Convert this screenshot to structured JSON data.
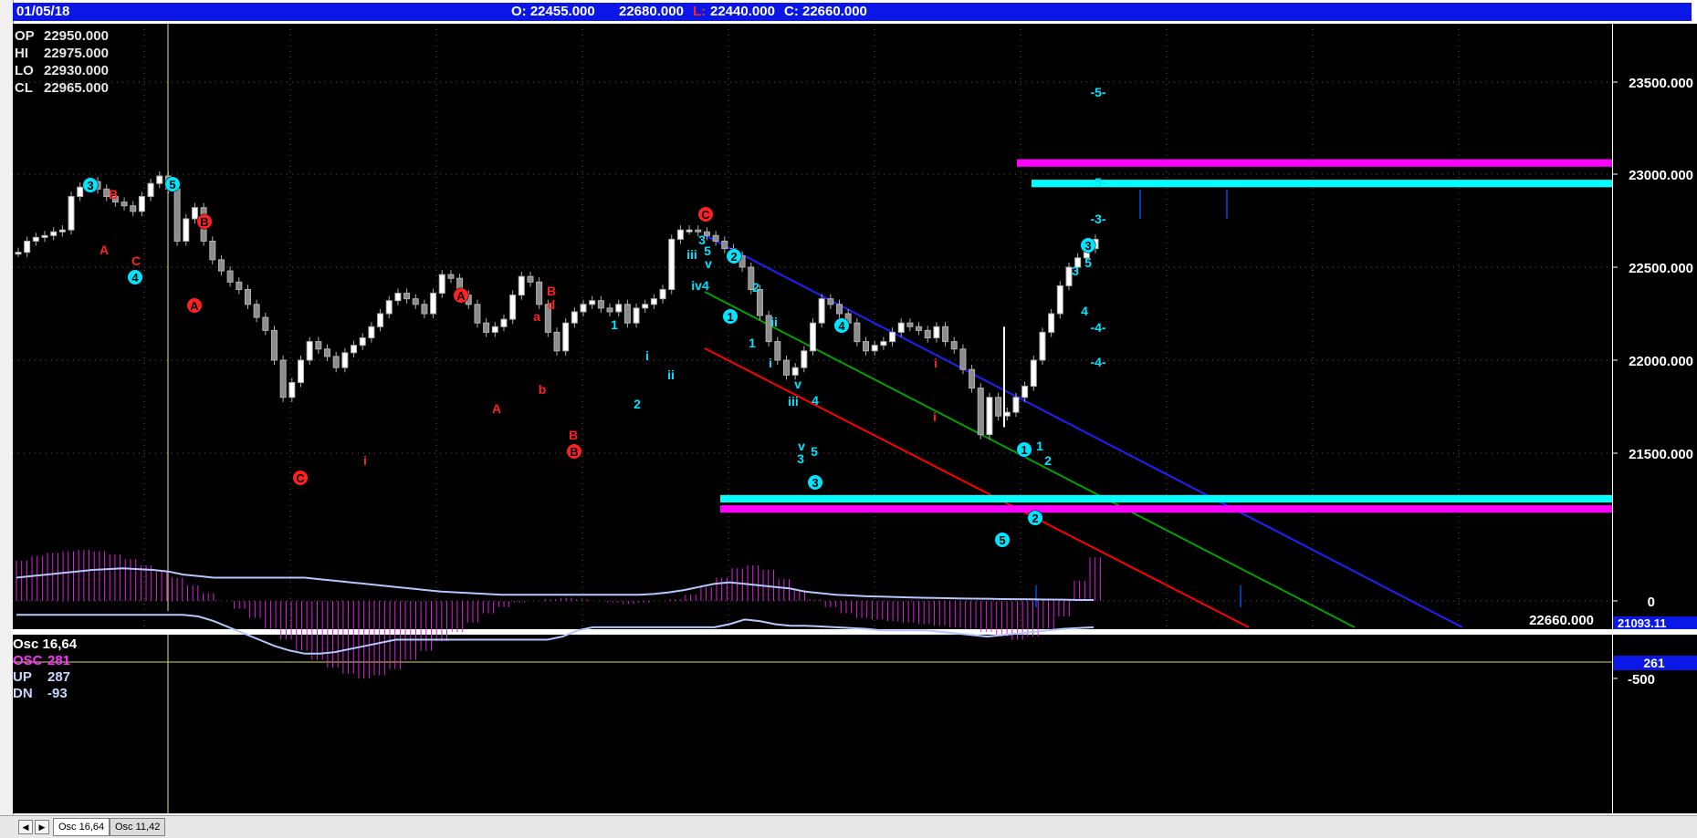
{
  "topbar": {
    "date": "01/05/18",
    "open": "O: 22455.000",
    "high": "22680.000",
    "low_tag": "L:",
    "low": "22440.000",
    "close": "C: 22660.000"
  },
  "ohlc_box": [
    {
      "label": "OP",
      "value": "22950.000"
    },
    {
      "label": "HI",
      "value": "22975.000"
    },
    {
      "label": "LO",
      "value": "22930.000"
    },
    {
      "label": "CL",
      "value": "22965.000"
    }
  ],
  "price_axis": {
    "ticks": [
      "23500.000",
      "23000.000",
      "22500.000",
      "22000.000",
      "21500.000"
    ],
    "last_price": "22660.000",
    "cut_label": "21093.11"
  },
  "osc_legend": [
    {
      "label": "Osc 16,64",
      "value": "",
      "color": "#ffffff"
    },
    {
      "label": "OSC",
      "value": "281",
      "color": "#ff33ff"
    },
    {
      "label": "UP",
      "value": "287",
      "color": "#b4c8ff"
    },
    {
      "label": "DN",
      "value": "-93",
      "color": "#b4c8ff"
    }
  ],
  "osc_axis": {
    "ticks": [
      "0",
      "-500"
    ],
    "current": "261"
  },
  "tabs": [
    "Osc 16,64",
    "Osc 11,42"
  ],
  "colors": {
    "background": "#000000",
    "header": "#0a17e6",
    "candle": "#b0b0b0",
    "wave_red": "#ff2020",
    "wave_cyan": "#00e5ff",
    "histogram": "#e020e0",
    "channel_blue": "#2020ff",
    "channel_green": "#00a000",
    "channel_red": "#ff0000",
    "zone_magenta": "#ff00ff",
    "zone_cyan": "#00ffff"
  },
  "chart_data": {
    "type": "candlestick",
    "price_series": [
      22580,
      22640,
      22660,
      22670,
      22690,
      22700,
      22880,
      22930,
      22960,
      22920,
      22880,
      22850,
      22830,
      22800,
      22880,
      22950,
      22990,
      22920,
      22640,
      22760,
      22820,
      22640,
      22540,
      22480,
      22420,
      22380,
      22300,
      22230,
      22160,
      22000,
      21800,
      21880,
      22000,
      22100,
      22060,
      22020,
      21960,
      22040,
      22080,
      22120,
      22180,
      22250,
      22320,
      22360,
      22330,
      22300,
      22250,
      22360,
      22460,
      22440,
      22350,
      22300,
      22200,
      22150,
      22180,
      22220,
      22350,
      22450,
      22420,
      22300,
      22150,
      22050,
      22200,
      22260,
      22300,
      22320,
      22280,
      22260,
      22300,
      22200,
      22280,
      22300,
      22330,
      22380,
      22650,
      22700,
      22700,
      22690,
      22670,
      22640,
      22600,
      22560,
      22500,
      22380,
      22240,
      22100,
      22000,
      21920,
      21960,
      22050,
      22200,
      22330,
      22300,
      22250,
      22200,
      22100,
      22050,
      22080,
      22100,
      22150,
      22200,
      22180,
      22160,
      22120,
      22180,
      22100,
      22060,
      21950,
      21850,
      21600,
      21800,
      21700,
      21720,
      21800,
      21860,
      22000,
      22150,
      22250,
      22400,
      22500,
      22550,
      22600,
      22650
    ],
    "price_axis_ticks": [
      23500,
      23000,
      22500,
      22000,
      21500
    ],
    "wave_labels": [
      {
        "text": "3",
        "color": "cyan",
        "circled": true
      },
      {
        "text": "B",
        "color": "red",
        "circled": false
      },
      {
        "text": "5",
        "color": "cyan",
        "circled": true
      },
      {
        "text": "A",
        "color": "red",
        "circled": false
      },
      {
        "text": "C",
        "color": "red",
        "circled": false
      },
      {
        "text": "4",
        "color": "cyan",
        "circled": true
      },
      {
        "text": "B",
        "color": "red",
        "circled": true
      },
      {
        "text": "A",
        "color": "red",
        "circled": true
      },
      {
        "text": "C",
        "color": "red",
        "circled": true
      },
      {
        "text": "i",
        "color": "red",
        "circled": false
      },
      {
        "text": "A",
        "color": "red",
        "circled": true
      },
      {
        "text": "A",
        "color": "red",
        "circled": false
      },
      {
        "text": "a",
        "color": "red",
        "circled": false
      },
      {
        "text": "B",
        "color": "red",
        "circled": false
      },
      {
        "text": "d",
        "color": "red",
        "circled": false
      },
      {
        "text": "b",
        "color": "red",
        "circled": false
      },
      {
        "text": "B",
        "color": "red",
        "circled": false
      },
      {
        "text": "B",
        "color": "red",
        "circled": true
      },
      {
        "text": "1",
        "color": "cyan",
        "circled": false
      },
      {
        "text": "i",
        "color": "cyan",
        "circled": false
      },
      {
        "text": "ii",
        "color": "cyan",
        "circled": false
      },
      {
        "text": "2",
        "color": "cyan",
        "circled": false
      },
      {
        "text": "C",
        "color": "red",
        "circled": true
      },
      {
        "text": "3",
        "color": "cyan",
        "circled": false
      },
      {
        "text": "5",
        "color": "cyan",
        "circled": false
      },
      {
        "text": "iii",
        "color": "cyan",
        "circled": false
      },
      {
        "text": "v",
        "color": "cyan",
        "circled": false
      },
      {
        "text": "iv4",
        "color": "cyan",
        "circled": false
      },
      {
        "text": "2",
        "color": "cyan",
        "circled": true
      },
      {
        "text": "2",
        "color": "cyan",
        "circled": false
      },
      {
        "text": "1",
        "color": "cyan",
        "circled": true
      },
      {
        "text": "ii",
        "color": "cyan",
        "circled": false
      },
      {
        "text": "1",
        "color": "cyan",
        "circled": false
      },
      {
        "text": "i",
        "color": "cyan",
        "circled": false
      },
      {
        "text": "v",
        "color": "cyan",
        "circled": false
      },
      {
        "text": "iii",
        "color": "cyan",
        "circled": false
      },
      {
        "text": "4",
        "color": "cyan",
        "circled": false
      },
      {
        "text": "v",
        "color": "cyan",
        "circled": false
      },
      {
        "text": "3",
        "color": "cyan",
        "circled": false
      },
      {
        "text": "5",
        "color": "cyan",
        "circled": false
      },
      {
        "text": "3",
        "color": "cyan",
        "circled": true
      },
      {
        "text": "4",
        "color": "cyan",
        "circled": true
      },
      {
        "text": "i",
        "color": "red",
        "circled": false
      },
      {
        "text": "i",
        "color": "red",
        "circled": false
      },
      {
        "text": "1",
        "color": "cyan",
        "circled": true
      },
      {
        "text": "1",
        "color": "cyan",
        "circled": false
      },
      {
        "text": "2",
        "color": "cyan",
        "circled": false
      },
      {
        "text": "2",
        "color": "cyan",
        "circled": true
      },
      {
        "text": "5",
        "color": "cyan",
        "circled": true
      },
      {
        "text": "3",
        "color": "cyan",
        "circled": true
      },
      {
        "text": "3",
        "color": "cyan",
        "circled": false
      },
      {
        "text": "5",
        "color": "cyan",
        "circled": false
      },
      {
        "text": "4",
        "color": "cyan",
        "circled": false
      },
      {
        "text": "-5-",
        "color": "cyan",
        "circled": false
      },
      {
        "text": "-5-",
        "color": "cyan",
        "circled": false
      },
      {
        "text": "-3-",
        "color": "cyan",
        "circled": false
      },
      {
        "text": "-4-",
        "color": "cyan",
        "circled": false
      },
      {
        "text": "-4-",
        "color": "cyan",
        "circled": false
      }
    ],
    "zones": [
      {
        "color": "magenta",
        "from": 23040,
        "to": 23080
      },
      {
        "color": "cyan",
        "from": 22930,
        "to": 22970
      },
      {
        "color": "cyan",
        "from": 21235,
        "to": 21275
      },
      {
        "color": "magenta",
        "from": 21180,
        "to": 21220
      }
    ],
    "osc": {
      "histogram": [
        260,
        290,
        310,
        320,
        330,
        320,
        300,
        270,
        230,
        190,
        150,
        100,
        50,
        0,
        -50,
        -110,
        -180,
        -250,
        -320,
        -380,
        -430,
        -470,
        -500,
        -480,
        -440,
        -380,
        -320,
        -260,
        -200,
        -140,
        -80,
        -40,
        -10,
        0,
        10,
        20,
        10,
        0,
        -10,
        -20,
        -10,
        0,
        10,
        40,
        90,
        150,
        210,
        230,
        200,
        140,
        70,
        10,
        -40,
        -80,
        -110,
        -120,
        -130,
        -140,
        -150,
        -160,
        -170,
        -180,
        -200,
        -230,
        -250,
        -230,
        -180,
        -100,
        130,
        281
      ],
      "up_line": [
        150,
        160,
        170,
        180,
        190,
        200,
        205,
        210,
        205,
        200,
        190,
        170,
        160,
        150,
        150,
        150,
        150,
        150,
        150,
        150,
        140,
        130,
        120,
        110,
        100,
        90,
        80,
        70,
        60,
        55,
        50,
        45,
        40,
        40,
        40,
        40,
        40,
        40,
        40,
        40,
        40,
        40,
        45,
        55,
        70,
        90,
        110,
        120,
        110,
        100,
        90,
        80,
        60,
        50,
        40,
        35,
        30,
        28,
        25,
        22,
        20,
        18,
        16,
        15,
        14,
        12,
        11,
        10,
        9,
        8,
        6,
        6
      ],
      "dn_line": [
        -90,
        -90,
        -90,
        -90,
        -90,
        -90,
        -90,
        -90,
        -90,
        -90,
        -90,
        -90,
        -100,
        -130,
        -170,
        -210,
        -250,
        -290,
        -320,
        -340,
        -340,
        -330,
        -310,
        -290,
        -270,
        -250,
        -250,
        -250,
        -250,
        -250,
        -250,
        -250,
        -250,
        -250,
        -250,
        -250,
        -230,
        -190,
        -170,
        -170,
        -170,
        -170,
        -170,
        -170,
        -170,
        -170,
        -170,
        -150,
        -120,
        -130,
        -150,
        -160,
        -160,
        -165,
        -170,
        -175,
        -180,
        -190,
        -190,
        -190,
        -190,
        -200,
        -210,
        -220,
        -230,
        -220,
        -210,
        -200,
        -190,
        -180,
        -175,
        -170
      ],
      "axis_ticks": [
        0,
        -500
      ]
    }
  }
}
